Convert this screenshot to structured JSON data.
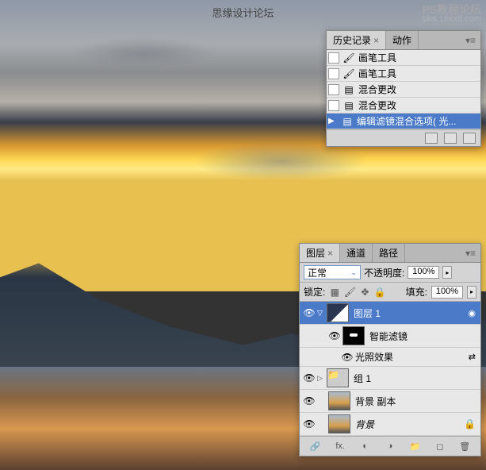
{
  "watermark": {
    "top": "思缘设计论坛",
    "right1": "PS教程论坛",
    "right2": "bbs.16xx8.com"
  },
  "history": {
    "tabs": [
      {
        "label": "历史记录",
        "active": true
      },
      {
        "label": "动作",
        "active": false
      }
    ],
    "items": [
      {
        "icon": "brush",
        "label": "画笔工具"
      },
      {
        "icon": "brush",
        "label": "画笔工具"
      },
      {
        "icon": "doc",
        "label": "混合更改"
      },
      {
        "icon": "doc",
        "label": "混合更改"
      },
      {
        "icon": "doc",
        "label": "编辑滤镜混合选项( 光...",
        "selected": true
      }
    ]
  },
  "layers": {
    "tabs": [
      {
        "label": "图层",
        "active": true
      },
      {
        "label": "通道",
        "active": false
      },
      {
        "label": "路径",
        "active": false
      }
    ],
    "opts": {
      "blend": "正常",
      "opacity_label": "不透明度:",
      "opacity": "100%",
      "lock_label": "锁定:",
      "fill_label": "填充:",
      "fill": "100%"
    },
    "rows": [
      {
        "type": "layer",
        "name": "图层 1",
        "selected": true,
        "expanded": true,
        "fx": true
      },
      {
        "type": "smart_head",
        "name": "智能滤镜"
      },
      {
        "type": "smart_item",
        "name": "光照效果"
      },
      {
        "type": "group",
        "name": "组 1"
      },
      {
        "type": "layer2",
        "name": "背景 副本"
      },
      {
        "type": "bg",
        "name": "背景"
      }
    ]
  }
}
